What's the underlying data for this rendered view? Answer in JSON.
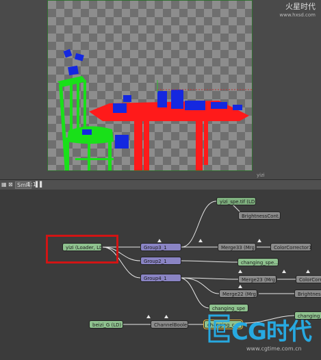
{
  "header": {
    "logo_text": "火星时代",
    "logo_sub": "www.hxsd.com"
  },
  "viewer": {
    "footer_label": "yizi"
  },
  "toolbar": {
    "fit_label": "SmR",
    "zoom_label": "1:1"
  },
  "nodes": {
    "yizi_spe": "yizi_spe.tif (LD)",
    "brightness1": "BrightnessCont...",
    "yizi_loader": "yizi (Loader, LD)",
    "group3": "Group3_1",
    "merge33": "Merge33 (Mrg)",
    "colorcorr1": "ColorCorrector1",
    "group2": "Group2_1",
    "changing1": "changing_spe...",
    "group4": "Group4_1",
    "merge23": "Merge23 (Mrg)",
    "colorcorr2": "ColorCorrec",
    "merge22": "Merge22 (Mrg)",
    "brightness2": "BrightnessCo",
    "changing2": "changing_spe",
    "changing3": "changing_sp",
    "beizi": "beizi_G (LD)",
    "channelbool": "ChannelBoole...",
    "changing4": "changing_c..."
  },
  "watermark": {
    "brand": "CG时代",
    "url": "www.cgtime.com.cn"
  },
  "colors": {
    "highlight": "#d21414",
    "loader_node": "#7fb07f",
    "group_node": "#8a84c4",
    "tool_node": "#8b8b8b",
    "watermark": "#27a9e1"
  }
}
